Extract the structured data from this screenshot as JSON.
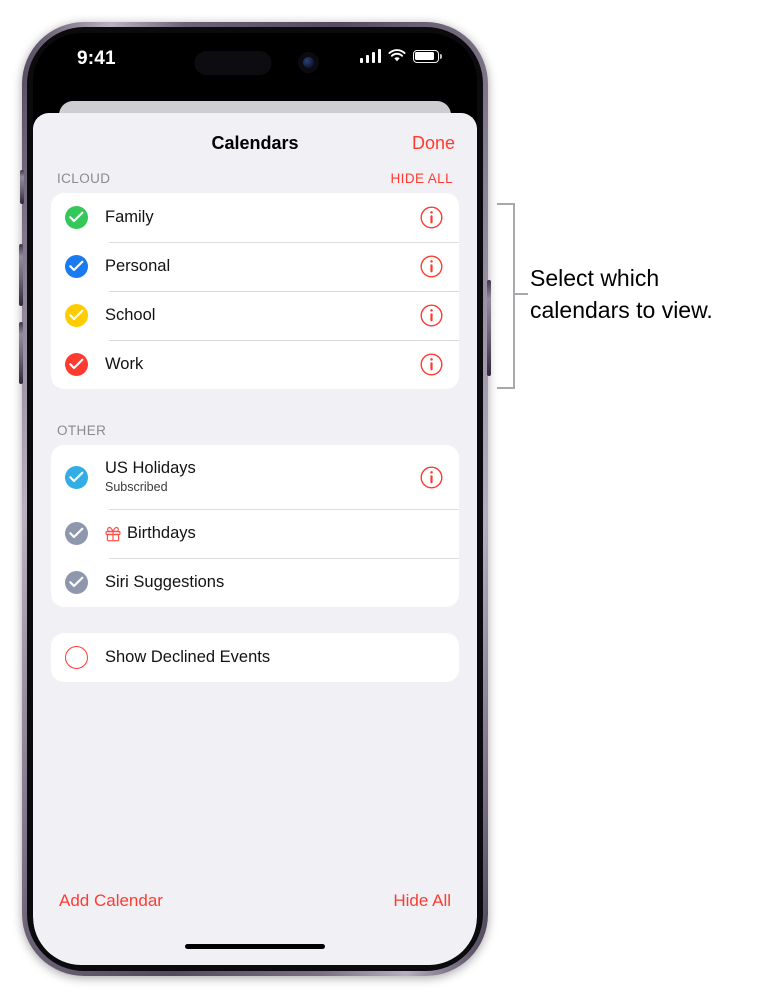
{
  "status_bar": {
    "time": "9:41",
    "cellular_icon": "cellular-signal-icon",
    "wifi_icon": "wifi-icon",
    "battery_icon": "battery-full-icon"
  },
  "nav": {
    "title": "Calendars",
    "done_label": "Done"
  },
  "sections": [
    {
      "id": "icloud",
      "title": "ICLOUD",
      "action_label": "HIDE ALL",
      "rows": [
        {
          "label": "Family",
          "checked": true,
          "color": "#34c759",
          "info": true
        },
        {
          "label": "Personal",
          "checked": true,
          "color": "#1a7aef",
          "info": true
        },
        {
          "label": "School",
          "checked": true,
          "color": "#ffcc00",
          "info": true
        },
        {
          "label": "Work",
          "checked": true,
          "color": "#ff3b30",
          "info": true
        }
      ]
    },
    {
      "id": "other",
      "title": "OTHER",
      "action_label": "",
      "rows": [
        {
          "label": "US Holidays",
          "subtitle": "Subscribed",
          "checked": true,
          "color": "#32ade6",
          "info": true
        },
        {
          "label": "Birthdays",
          "checked": true,
          "color": "#8e97ab",
          "info": false,
          "icon": "gift-icon",
          "icon_color": "#ff4f4a"
        },
        {
          "label": "Siri Suggestions",
          "checked": true,
          "color": "#8e97ab",
          "info": false
        }
      ]
    }
  ],
  "declined": {
    "label": "Show Declined Events",
    "checked": false,
    "outline_color": "#ff3b30"
  },
  "toolbar": {
    "add_calendar_label": "Add Calendar",
    "hide_all_label": "Hide All"
  },
  "callout": {
    "text": "Select which\ncalendars to view."
  },
  "colors": {
    "accent_red": "#ff3b30",
    "sheet_bg": "#f1f0f5",
    "card_bg": "#ffffff",
    "section_title": "#8a8a8f"
  }
}
